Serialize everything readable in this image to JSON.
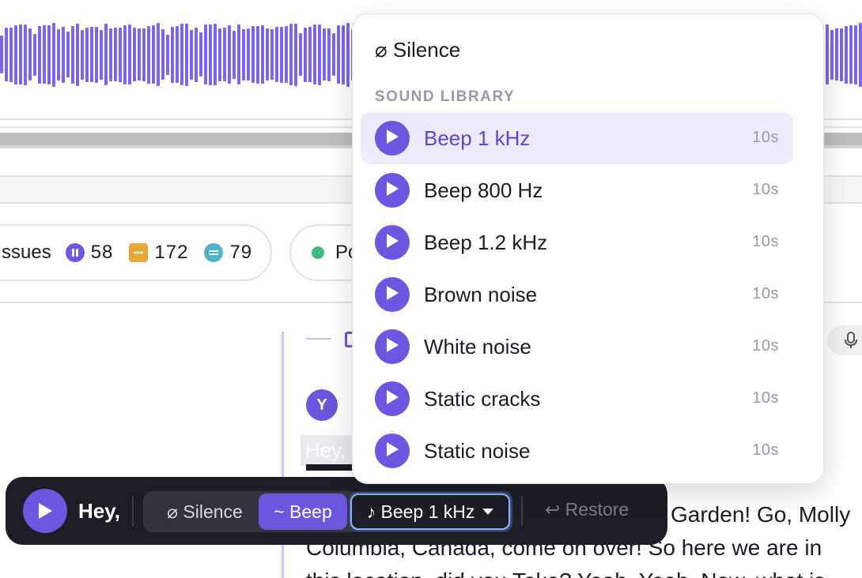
{
  "stats_bar": {
    "label": "ssues",
    "stats": [
      {
        "icon": "pause-circle-icon",
        "value": "58",
        "color": "#6b57e0"
      },
      {
        "icon": "comment-icon",
        "value": "172",
        "color": "#e8a93b"
      },
      {
        "icon": "strikethrough-circle-icon",
        "value": "79",
        "color": "#4fb3c9"
      }
    ],
    "status_label": "Po",
    "status_color": "#3cba7e"
  },
  "transcript": {
    "speaker_initial": "Y",
    "ghost_word": "Hey,",
    "line1": "Garden! Go, Molly",
    "line2": "Columbia, Canada, come on over! So here we are in",
    "line3": "this location, did you Take? Yeah. Yeah. Now, what is"
  },
  "toolbar": {
    "word": "Hey,",
    "silence_label": "⌀ Silence",
    "beep_label": "~ Beep",
    "sound_label": "♪ Beep 1 kHz",
    "restore_label": "↩ Restore"
  },
  "dropdown": {
    "silence_label": "⌀ Silence",
    "section_header": "SOUND LIBRARY",
    "items": [
      {
        "label": "Beep 1 kHz",
        "duration": "10s",
        "active": true
      },
      {
        "label": "Beep 800 Hz",
        "duration": "10s"
      },
      {
        "label": "Beep 1.2 kHz",
        "duration": "10s"
      },
      {
        "label": "Brown noise",
        "duration": "10s"
      },
      {
        "label": "White noise",
        "duration": "10s"
      },
      {
        "label": "Static cracks",
        "duration": "10s"
      },
      {
        "label": "Static noise",
        "duration": "10s"
      }
    ]
  },
  "colors": {
    "accent": "#6b57e0",
    "waveform": "#7a66e8",
    "toolbar_bg": "#1d1d26"
  }
}
